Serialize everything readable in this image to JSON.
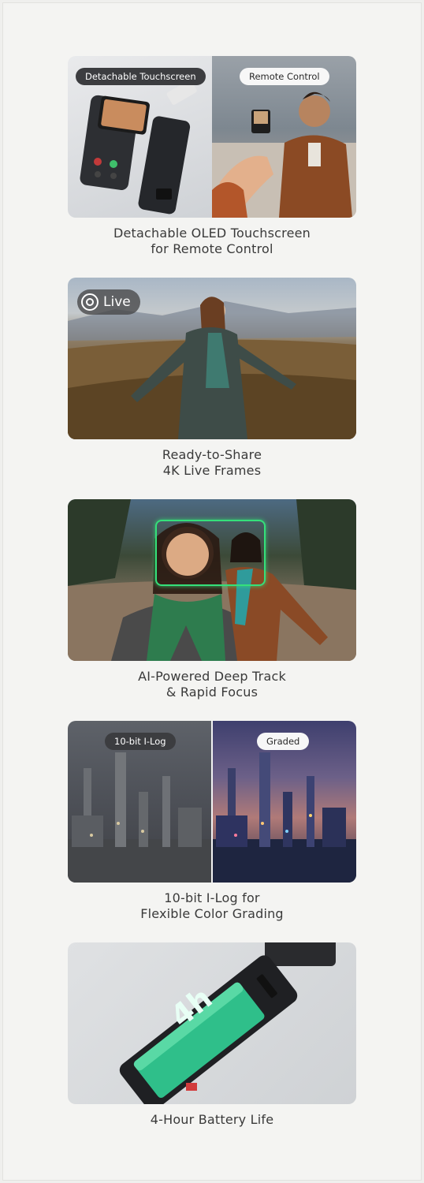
{
  "features": [
    {
      "badges": {
        "left": "Detachable Touchscreen",
        "right": "Remote Control"
      },
      "caption": [
        "Detachable OLED Touchscreen",
        "for Remote Control"
      ]
    },
    {
      "badges": {
        "live": "Live"
      },
      "caption": [
        "Ready-to-Share",
        "4K Live Frames"
      ]
    },
    {
      "caption": [
        "AI-Powered Deep Track",
        "& Rapid Focus"
      ]
    },
    {
      "badges": {
        "left": "10-bit I-Log",
        "right": "Graded"
      },
      "caption": [
        "10-bit I-Log for",
        "Flexible Color Grading"
      ]
    },
    {
      "badges": {
        "battery": "4h"
      },
      "caption": [
        "4-Hour Battery Life"
      ]
    }
  ],
  "colors": {
    "track_box": "#35e07a",
    "battery_green": "#2fbf8a",
    "page_bg": "#f4f4f2"
  }
}
